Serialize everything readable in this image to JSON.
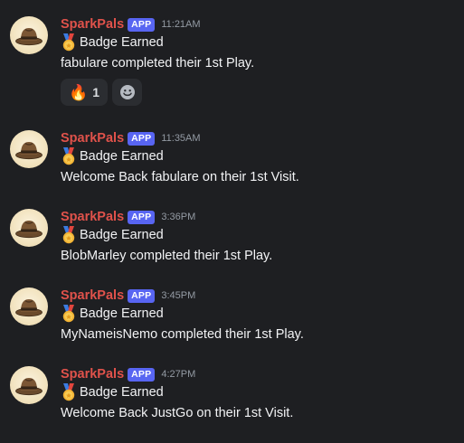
{
  "messages": [
    {
      "author": "SparkPals",
      "tag": "APP",
      "time": "11:21AM",
      "title": "Badge Earned",
      "body": "fabulare completed their 1st Play.",
      "reactions": [
        {
          "emoji": "🔥",
          "count": "1"
        }
      ]
    },
    {
      "author": "SparkPals",
      "tag": "APP",
      "time": "11:35AM",
      "title": "Badge Earned",
      "body": "Welcome Back fabulare on their 1st Visit."
    },
    {
      "author": "SparkPals",
      "tag": "APP",
      "time": "3:36PM",
      "title": "Badge Earned",
      "body": "BlobMarley completed their 1st Play."
    },
    {
      "author": "SparkPals",
      "tag": "APP",
      "time": "3:45PM",
      "title": "Badge Earned",
      "body": "MyNameisNemo completed their 1st Play."
    },
    {
      "author": "SparkPals",
      "tag": "APP",
      "time": "4:27PM",
      "title": "Badge Earned",
      "body": "Welcome Back JustGo on their 1st Visit."
    }
  ],
  "icons": {
    "avatar": "fedora-hat-icon",
    "medal": "medal-icon",
    "add_reaction": "add-reaction-icon"
  },
  "colors": {
    "background": "#1e1f22",
    "username": "#e0524b",
    "app_tag": "#5865f2",
    "timestamp": "#949ba4"
  }
}
